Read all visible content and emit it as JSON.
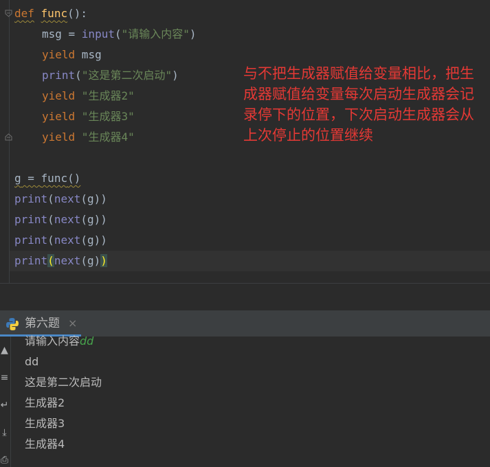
{
  "editor": {
    "lines": [
      {
        "k": "def",
        "fn": "func",
        "rest": "():"
      },
      {
        "var": "msg = ",
        "bi": "input",
        "open": "(",
        "str": "\"请输入内容\"",
        "close": ")"
      },
      {
        "kw": "yield",
        "rest": " msg"
      },
      {
        "bi": "print",
        "open": "(",
        "str": "\"这是第二次启动\"",
        "close": ")"
      },
      {
        "kw": "yield",
        "str": " \"生成器2\""
      },
      {
        "kw": "yield",
        "str": " \"生成器3\""
      },
      {
        "kw": "yield",
        "str": " \"生成器4\""
      },
      {
        "a": "g",
        "b": " = ",
        "c": "func",
        "d": "()"
      },
      {
        "bi": "print",
        "mid": "(",
        "bi2": "next",
        "rest": "(g))"
      },
      {
        "bi": "print",
        "mid": "(",
        "bi2": "next",
        "rest": "(g))"
      },
      {
        "bi": "print",
        "mid": "(",
        "bi2": "next",
        "rest": "(g))"
      },
      {
        "bi": "print",
        "mid": "(",
        "bi2": "next",
        "rest": "(g)",
        "end": ")"
      }
    ]
  },
  "annotation": "与不把生成器赋值给变量相比，把生成器赋值给变量每次启动生成器会记录停下的位置，下次启动生成器会从上次停止的位置继续",
  "run_panel": {
    "tab_label": "第六题",
    "tab_close": "×",
    "output": [
      {
        "text": "请输入内容",
        "input": "dd"
      },
      {
        "text": "dd"
      },
      {
        "text": "这是第二次启动"
      },
      {
        "text": "生成器2"
      },
      {
        "text": "生成器3"
      },
      {
        "text": "生成器4"
      }
    ]
  },
  "colors": {
    "keyword": "#cc7832",
    "function": "#ffc66d",
    "builtin": "#8888c6",
    "string": "#6a8759",
    "annotation": "#e53935",
    "tab_accent": "#4a88c7"
  }
}
